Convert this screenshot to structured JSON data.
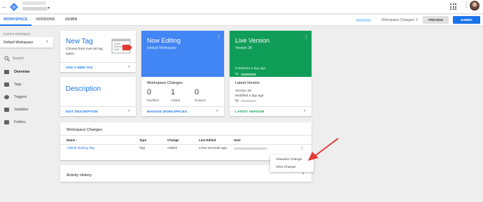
{
  "colors": {
    "accent_blue": "#1a73e8",
    "now_editing_bg": "#4285f4",
    "live_version_bg": "#0f9d58",
    "annotation_red": "#e53935"
  },
  "topbar": {
    "back_icon": "back-arrow-icon",
    "logo_icon": "tag-manager-logo-icon",
    "container_caret": "▾",
    "apps_icon": "apps-grid-icon",
    "more_icon": "⋮"
  },
  "navbar": {
    "tabs": [
      {
        "label": "WORKSPACE"
      },
      {
        "label": "VERSIONS"
      },
      {
        "label": "ADMIN"
      }
    ],
    "workspace_changes": "Workspace Changes: 1",
    "preview_label": "PREVIEW",
    "submit_label": "SUBMIT"
  },
  "sidebar": {
    "current_workspace_label": "Current Workspace",
    "current_workspace_value": "Default Workspace",
    "chevron": "›",
    "search_placeholder": "Search",
    "items": [
      {
        "label": "Overview",
        "icon": "overview-icon"
      },
      {
        "label": "Tags",
        "icon": "tag-icon"
      },
      {
        "label": "Triggers",
        "icon": "trigger-icon"
      },
      {
        "label": "Variables",
        "icon": "variables-icon"
      },
      {
        "label": "Folders",
        "icon": "folder-icon"
      }
    ]
  },
  "new_tag_card": {
    "title": "New Tag",
    "description": "Choose from over 50 tag types.",
    "link": "ADD A NEW TAG",
    "arrow": "›"
  },
  "description_card": {
    "title": "Description",
    "link": "EDIT DESCRIPTION",
    "arrow": "›"
  },
  "now_editing_card": {
    "title": "Now Editing",
    "subtitle": "Default Workspace",
    "menu": "⋮",
    "changes_title": "Workspace Changes",
    "counts": [
      {
        "value": "0",
        "label": "Modified"
      },
      {
        "value": "1",
        "label": "Added"
      },
      {
        "value": "0",
        "label": "Deleted"
      }
    ],
    "link": "MANAGE WORKSPACES",
    "arrow": "›"
  },
  "live_version_card": {
    "title": "Live Version",
    "subtitle": "Version 28",
    "menu": "⋮",
    "published": "Published a day ago",
    "by": "by",
    "latest_title": "Latest Version",
    "latest_version": "Version 28",
    "latest_modified": "Modified a day ago",
    "latest_by": "by",
    "link": "LATEST VERSION",
    "arrow": "›"
  },
  "workspace_changes_table": {
    "title": "Workspace Changes",
    "headers": [
      "Name ↑",
      "Type",
      "Change",
      "Last Edited",
      "User"
    ],
    "rows": [
      {
        "name": "AdRoll Testing Tag",
        "type": "Tag",
        "change": "Added",
        "last_edited": "a few seconds ago",
        "menu": "⋮"
      }
    ]
  },
  "context_menu": {
    "items": [
      "Abandon Change",
      "View Change"
    ]
  },
  "activity_history": {
    "title": "Activity History",
    "arrow": "›"
  }
}
